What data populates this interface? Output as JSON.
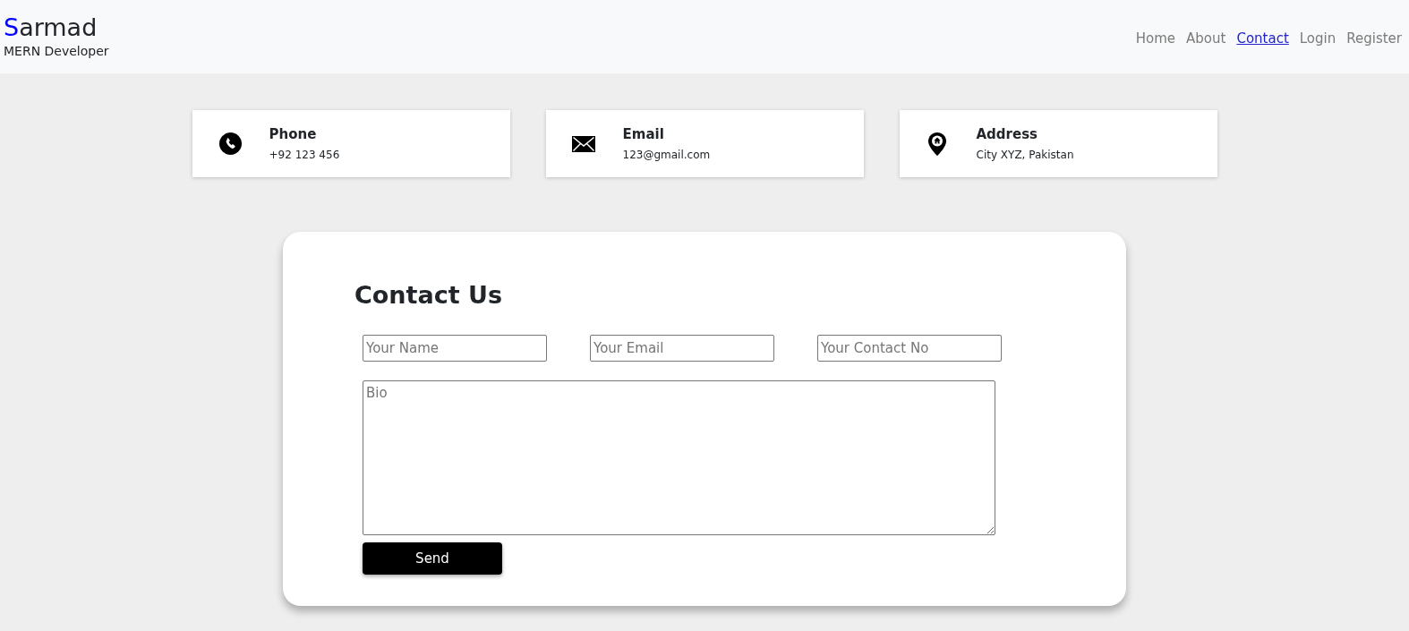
{
  "brand": {
    "name_accent": "S",
    "name_rest": "armad",
    "tagline": "MERN Developer"
  },
  "nav": [
    {
      "label": "Home",
      "selected": false
    },
    {
      "label": "About",
      "selected": false
    },
    {
      "label": "Contact",
      "selected": true
    },
    {
      "label": "Login",
      "selected": false
    },
    {
      "label": "Register",
      "selected": false
    }
  ],
  "info_cards": [
    {
      "kind": "phone",
      "title": "Phone",
      "value": "+92 123 456"
    },
    {
      "kind": "email",
      "title": "Email",
      "value": "123@gmail.com"
    },
    {
      "kind": "address",
      "title": "Address",
      "value": "City XYZ, Pakistan"
    }
  ],
  "form": {
    "title": "Contact Us",
    "fields": [
      {
        "placeholder": "Your Name"
      },
      {
        "placeholder": "Your Email"
      },
      {
        "placeholder": "Your Contact No"
      }
    ],
    "message": {
      "placeholder": "Bio"
    },
    "button": "Send"
  }
}
